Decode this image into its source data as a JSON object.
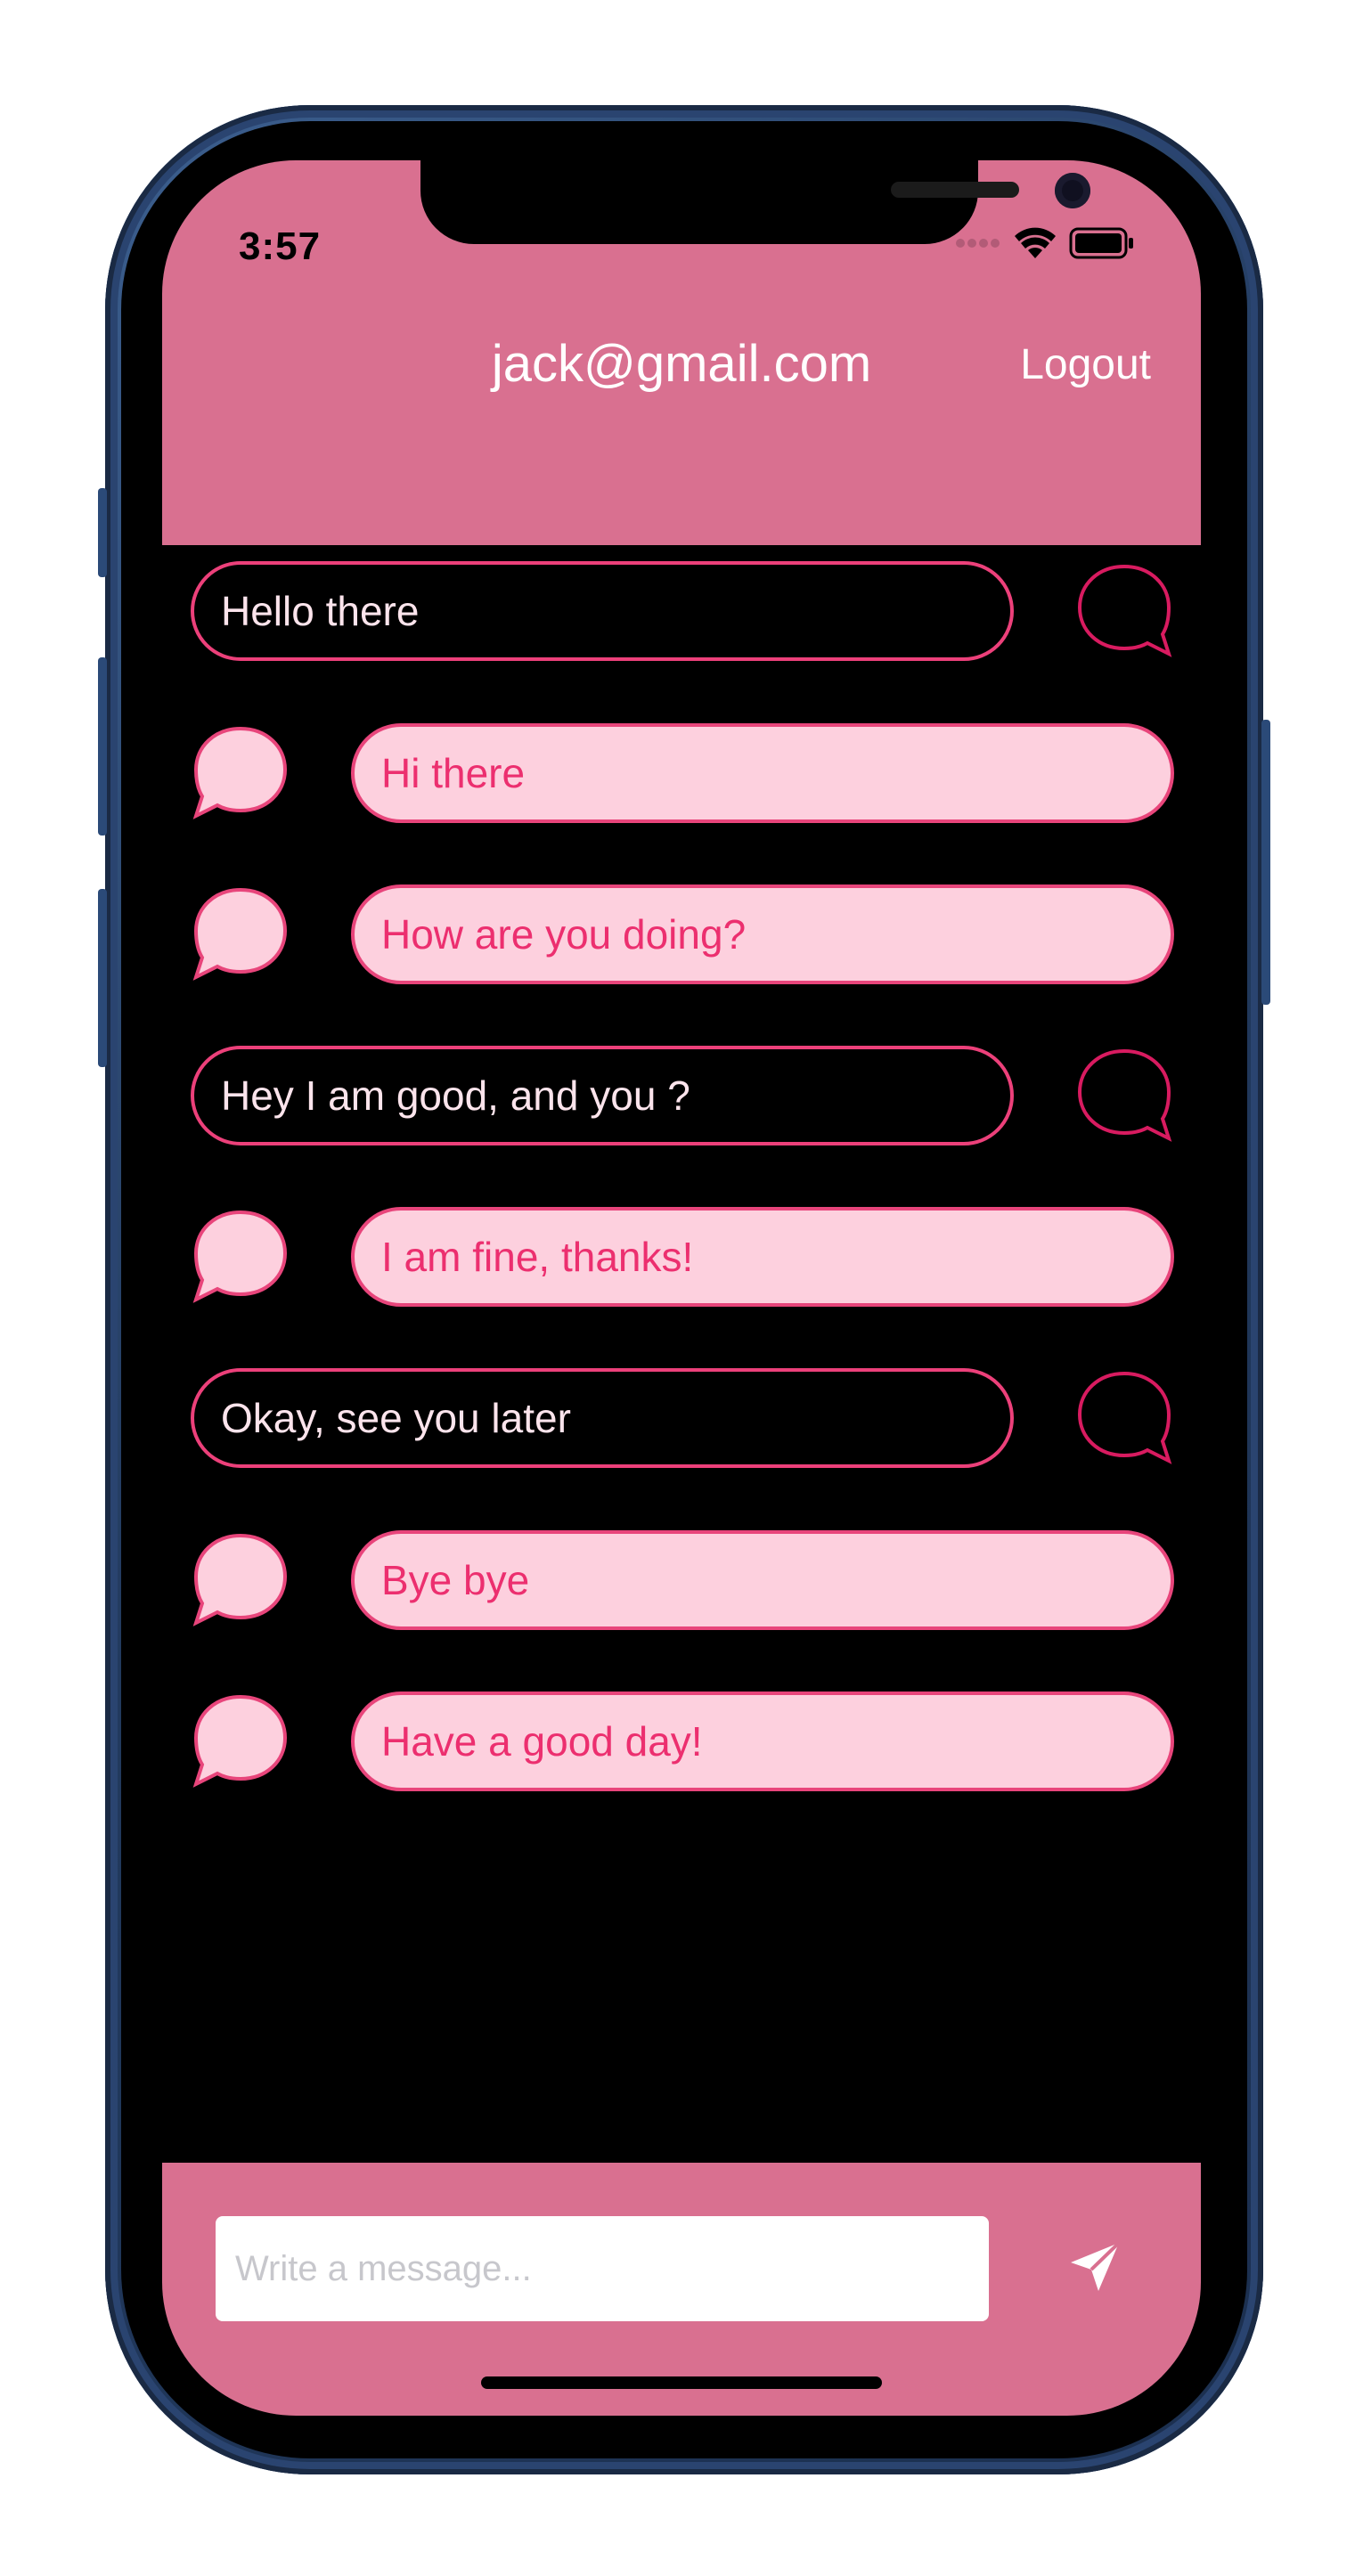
{
  "status_bar": {
    "time": "3:57"
  },
  "header": {
    "title": "jack@gmail.com",
    "logout_label": "Logout"
  },
  "messages": [
    {
      "text": "Hello there",
      "sender": "self"
    },
    {
      "text": "Hi there",
      "sender": "other"
    },
    {
      "text": "How are you doing?",
      "sender": "other"
    },
    {
      "text": "Hey I am good, and you ?",
      "sender": "self"
    },
    {
      "text": "I am fine, thanks!",
      "sender": "other"
    },
    {
      "text": "Okay, see you later",
      "sender": "self"
    },
    {
      "text": "Bye bye",
      "sender": "other"
    },
    {
      "text": "Have a good day!",
      "sender": "other"
    }
  ],
  "composer": {
    "placeholder": "Write a message...",
    "value": ""
  },
  "icons": {
    "self_avatar": "chat-bubble-outline-icon",
    "other_avatar": "chat-bubble-filled-icon",
    "send": "paper-plane-icon",
    "wifi": "wifi-icon",
    "battery": "battery-icon",
    "signal": "cellular-signal-icon"
  },
  "colors": {
    "header_bg": "#d97090",
    "screen_bg": "#000000",
    "accent": "#ec407a",
    "incoming_bubble_bg": "#fdd0de",
    "incoming_text": "#ec2f6f",
    "outgoing_text": "#fce4ec",
    "phone_frame": "#223a5e"
  }
}
